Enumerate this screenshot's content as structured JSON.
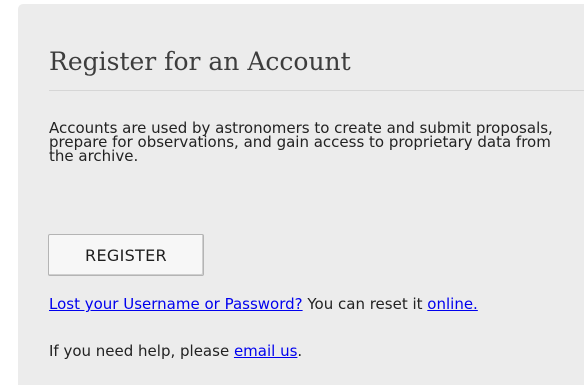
{
  "register": {
    "title": "Register for an Account",
    "description": "Accounts are used by astronomers to create and submit proposals, prepare for observations, and gain access to proprietary data from the archive.",
    "button_label": "REGISTER",
    "lost_link": "Lost your Username or Password?",
    "lost_text": " You can reset it ",
    "online_link": "online.",
    "help_text": "If you need help, please ",
    "email_link": "email us",
    "help_end": "."
  }
}
